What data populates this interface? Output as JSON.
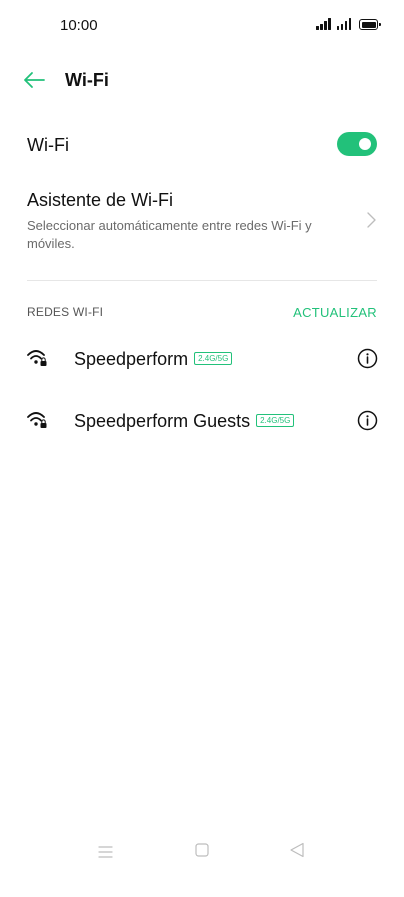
{
  "status_bar": {
    "time": "10:00"
  },
  "header": {
    "title": "Wi-Fi"
  },
  "wifi": {
    "label": "Wi-Fi",
    "enabled": true
  },
  "assistant": {
    "title": "Asistente de Wi-Fi",
    "subtitle": "Seleccionar automáticamente entre redes Wi-Fi y móviles."
  },
  "section": {
    "label": "REDES WI-FI",
    "action": "ACTUALIZAR"
  },
  "networks": [
    {
      "name": "Speedperform",
      "band": "2.4G/5G"
    },
    {
      "name": "Speedperform Guests",
      "band": "2.4G/5G"
    }
  ],
  "colors": {
    "accent": "#22c17a",
    "text": "#111111",
    "muted": "#6b6b6b"
  },
  "icons": {
    "back": "arrow-left-icon",
    "chevron": "chevron-right-icon",
    "wifi": "wifi-lock-icon",
    "info": "info-icon"
  }
}
